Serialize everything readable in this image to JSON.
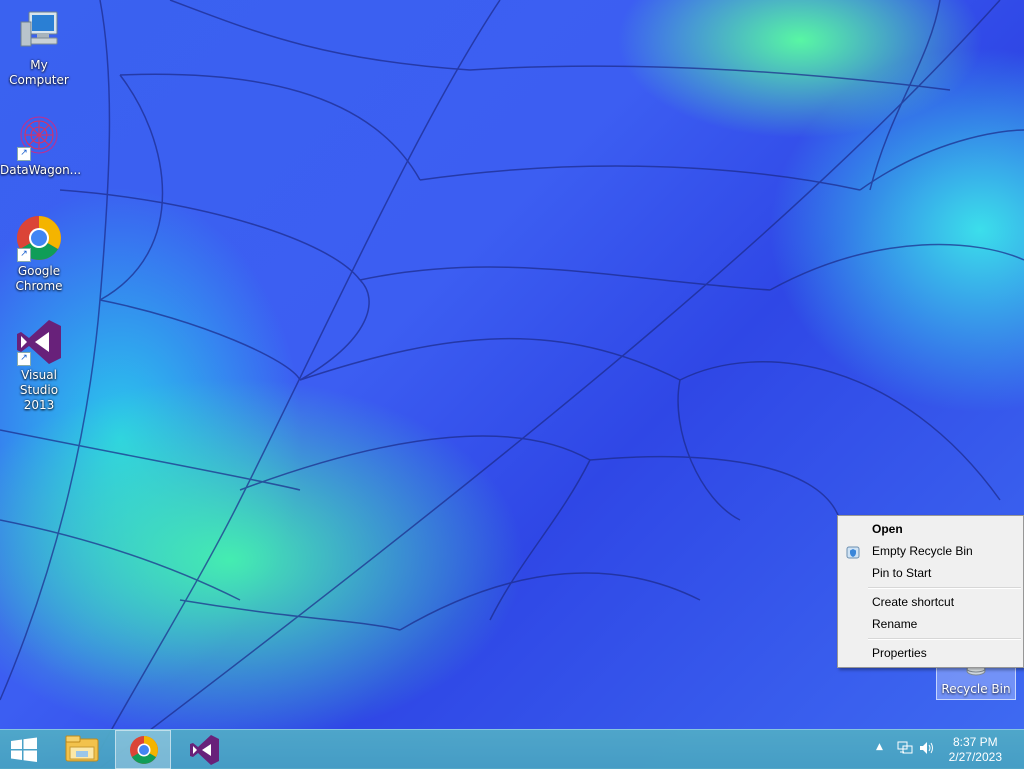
{
  "desktop": {
    "icons": [
      {
        "label": "My Computer"
      },
      {
        "label": "DataWagon..."
      },
      {
        "label": "Google Chrome"
      },
      {
        "label": "Visual Studio 2013"
      }
    ],
    "recycle_bin": {
      "label": "Recycle Bin",
      "selected": true
    }
  },
  "context_menu": {
    "items": [
      {
        "label": "Open",
        "default": true
      },
      {
        "label": "Empty Recycle Bin",
        "icon": "shield-icon"
      },
      {
        "label": "Pin to Start"
      },
      {
        "label": "Create shortcut"
      },
      {
        "label": "Rename"
      },
      {
        "label": "Properties"
      }
    ]
  },
  "taskbar": {
    "apps": [
      {
        "name": "file-explorer-icon"
      },
      {
        "name": "chrome-icon",
        "active": true
      },
      {
        "name": "visual-studio-icon"
      }
    ],
    "tray": {
      "icons": [
        "show-hidden-icons-icon",
        "network-icon",
        "volume-icon"
      ]
    },
    "clock": {
      "time": "8:37 PM",
      "date": "2/27/2023"
    }
  },
  "colors": {
    "taskbar": "#4aa6c6",
    "wallpaper_blue": "#3a5ef0",
    "wallpaper_green": "#46f8aa",
    "menu_bg": "#f0f0f0"
  }
}
